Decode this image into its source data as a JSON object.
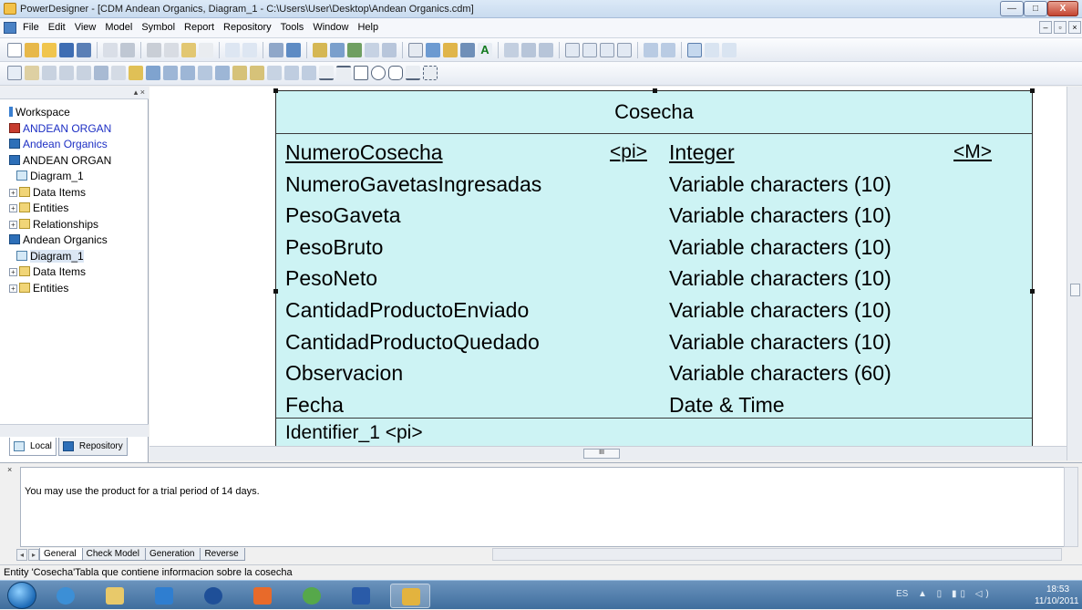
{
  "window": {
    "title": "PowerDesigner - [CDM Andean Organics, Diagram_1 - C:\\Users\\User\\Desktop\\Andean Organics.cdm]",
    "min_glyph": "—",
    "max_glyph": "□",
    "close_glyph": "X"
  },
  "menu": {
    "items": [
      "File",
      "Edit",
      "View",
      "Model",
      "Symbol",
      "Report",
      "Repository",
      "Tools",
      "Window",
      "Help"
    ],
    "mdi": [
      "–",
      "▫",
      "×"
    ]
  },
  "browser": {
    "items": [
      {
        "label": "Workspace",
        "icon": "workspace-icon"
      },
      {
        "label": "ANDEAN ORGAN",
        "icon": "model-icon"
      },
      {
        "label": "Andean Organics",
        "icon": "model-icon"
      },
      {
        "label": "ANDEAN ORGAN",
        "icon": "model-icon"
      },
      {
        "label": "Diagram_1",
        "icon": "diagram-icon"
      },
      {
        "label": "Data Items",
        "icon": "folder-icon"
      },
      {
        "label": "Entities",
        "icon": "folder-icon"
      },
      {
        "label": "Relationships",
        "icon": "folder-icon"
      },
      {
        "label": "Andean Organics",
        "icon": "model-icon"
      },
      {
        "label": "Diagram_1",
        "icon": "diagram-icon"
      },
      {
        "label": "Data Items",
        "icon": "folder-icon"
      },
      {
        "label": "Entities",
        "icon": "folder-icon"
      }
    ],
    "tabs": [
      "Local",
      "Repository"
    ]
  },
  "entity": {
    "title": "Cosecha",
    "attributes": [
      {
        "name": "NumeroCosecha",
        "pi": "<pi>",
        "type": "Integer",
        "mandatory": "<M>"
      },
      {
        "name": "NumeroGavetasIngresadas",
        "type": "Variable characters (10)"
      },
      {
        "name": "PesoGaveta",
        "type": "Variable characters (10)"
      },
      {
        "name": "PesoBruto",
        "type": "Variable characters (10)"
      },
      {
        "name": "PesoNeto",
        "type": "Variable characters (10)"
      },
      {
        "name": "CantidadProductoEnviado",
        "type": "Variable characters (10)"
      },
      {
        "name": "CantidadProductoQuedado",
        "type": "Variable characters (10)"
      },
      {
        "name": "Observacion",
        "type": "Variable characters (60)"
      },
      {
        "name": "Fecha",
        "type": "Date & Time"
      }
    ],
    "identifier": "Identifier_1  <pi>",
    "fill_color": "#cdf3f4"
  },
  "scroll": {
    "h_thumb": "III"
  },
  "output": {
    "message": "You may use the product for a trial period of 14 days.",
    "tabs": [
      "General",
      "Check Model",
      "Generation",
      "Reverse"
    ],
    "close_glyph": "×"
  },
  "status": {
    "text": "Entity 'Cosecha'Tabla que contiene informacion sobre la cosecha"
  },
  "taskbar": {
    "apps": [
      "internet-explorer-icon",
      "file-explorer-icon",
      "outlook-icon",
      "hp-icon",
      "app-icon",
      "users-icon",
      "word-icon",
      "powerdesigner-icon"
    ],
    "lang": "ES",
    "tray_icons": "▲ ▯ ▮▯ ◁)",
    "time": "18:53",
    "date": "11/10/2011"
  }
}
